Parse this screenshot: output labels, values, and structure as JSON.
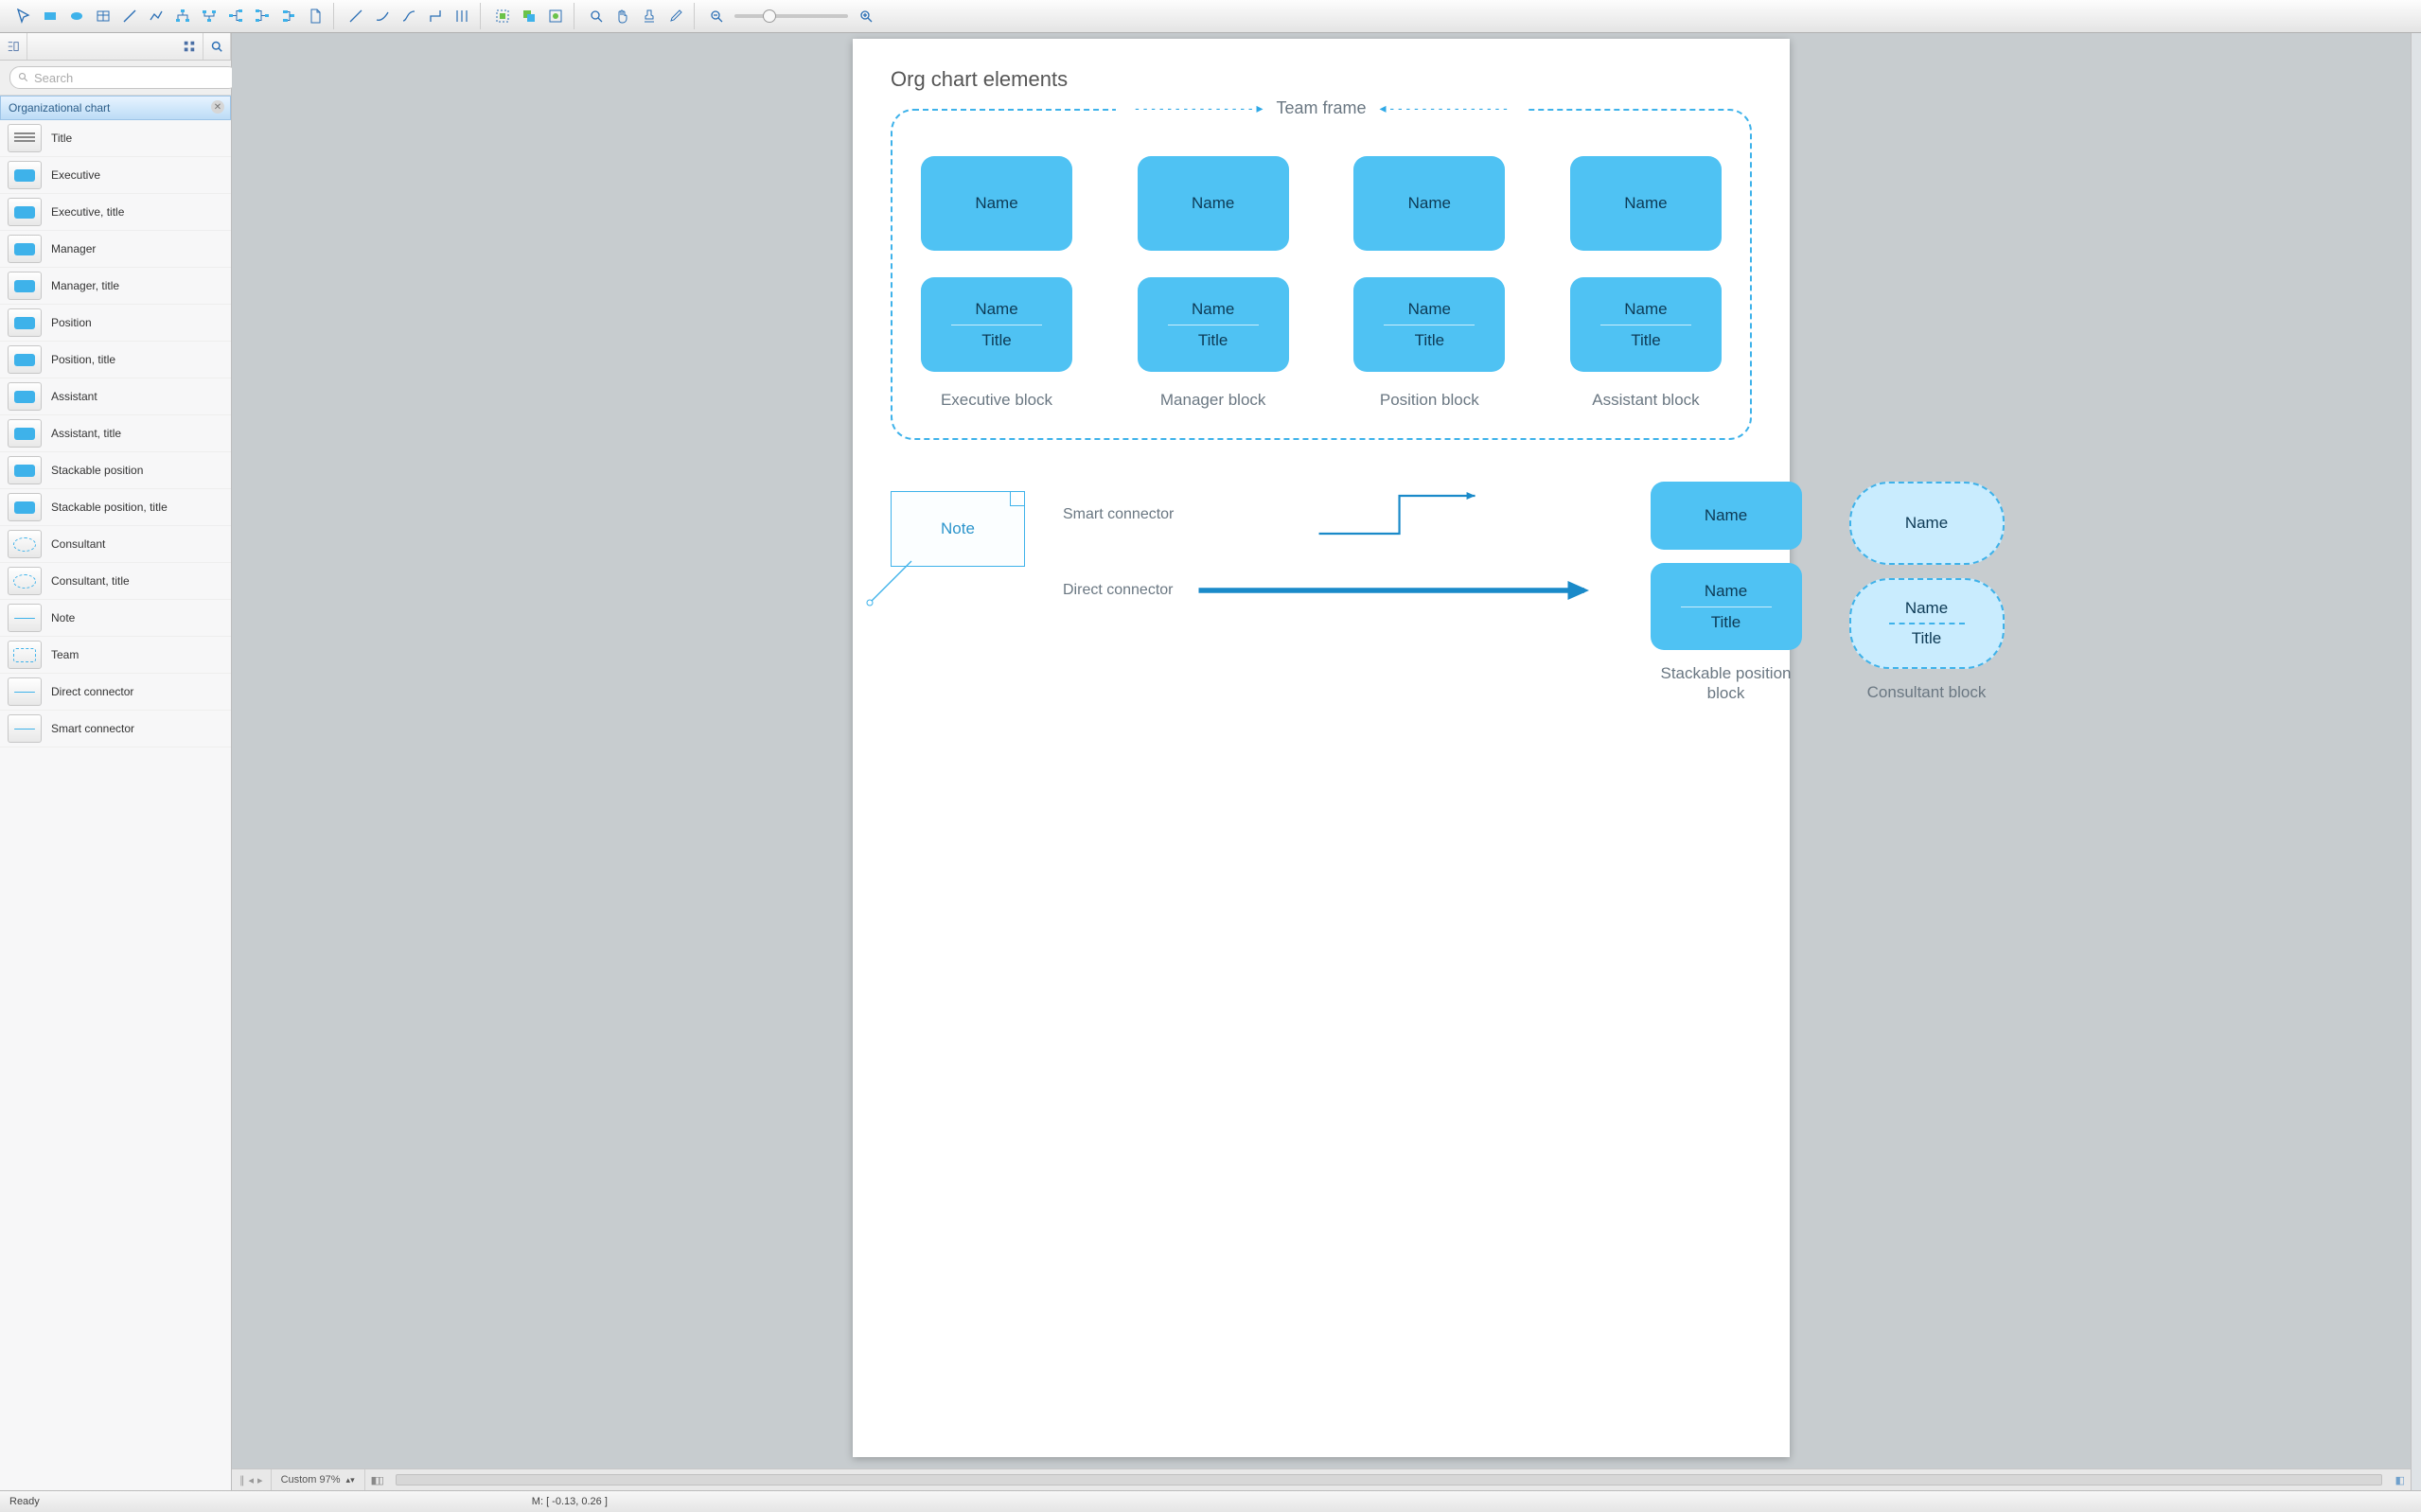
{
  "toolbar": {
    "groups": [
      [
        "pointer-icon",
        "rect-icon",
        "ellipse-icon",
        "table-icon",
        "line-icon",
        "polyline-icon",
        "tree1-icon",
        "tree2-icon",
        "tree3-icon",
        "tree4-icon",
        "tree5-icon",
        "page-icon"
      ],
      [
        "conn1-icon",
        "conn2-icon",
        "conn3-icon",
        "conn4-icon",
        "conn5-icon"
      ],
      [
        "grp1-icon",
        "grp2-icon",
        "grp3-icon"
      ],
      [
        "zoomfit-icon",
        "hand-icon",
        "stamp-icon",
        "eyedrop-icon"
      ]
    ]
  },
  "sidebar": {
    "search_placeholder": "Search",
    "section_title": "Organizational chart",
    "items": [
      {
        "label": "Title",
        "thumb": "bars"
      },
      {
        "label": "Executive",
        "thumb": "chip"
      },
      {
        "label": "Executive, title",
        "thumb": "chip"
      },
      {
        "label": "Manager",
        "thumb": "chip"
      },
      {
        "label": "Manager, title",
        "thumb": "chip"
      },
      {
        "label": "Position",
        "thumb": "chip"
      },
      {
        "label": "Position, title",
        "thumb": "chip"
      },
      {
        "label": "Assistant",
        "thumb": "chip"
      },
      {
        "label": "Assistant, title",
        "thumb": "chip"
      },
      {
        "label": "Stackable position",
        "thumb": "chip"
      },
      {
        "label": "Stackable position, title",
        "thumb": "chip"
      },
      {
        "label": "Consultant",
        "thumb": "ellipse"
      },
      {
        "label": "Consultant, title",
        "thumb": "ellipse"
      },
      {
        "label": "Note",
        "thumb": "line"
      },
      {
        "label": "Team",
        "thumb": "dash"
      },
      {
        "label": "Direct connector",
        "thumb": "line"
      },
      {
        "label": "Smart connector",
        "thumb": "line"
      }
    ]
  },
  "canvas": {
    "title": "Org chart elements",
    "team_frame_label": "Team frame",
    "name_text": "Name",
    "title_text": "Title",
    "columns": [
      "Executive block",
      "Manager block",
      "Position block",
      "Assistant block"
    ],
    "note_text": "Note",
    "smart_connector": "Smart connector",
    "direct_connector": "Direct connector",
    "stackable_caption": "Stackable position block",
    "consultant_caption": "Consultant block"
  },
  "hscroll": {
    "zoom_label": "Custom 97%"
  },
  "status": {
    "left": "Ready",
    "coords": "M: [ -0.13, 0.26 ]"
  }
}
